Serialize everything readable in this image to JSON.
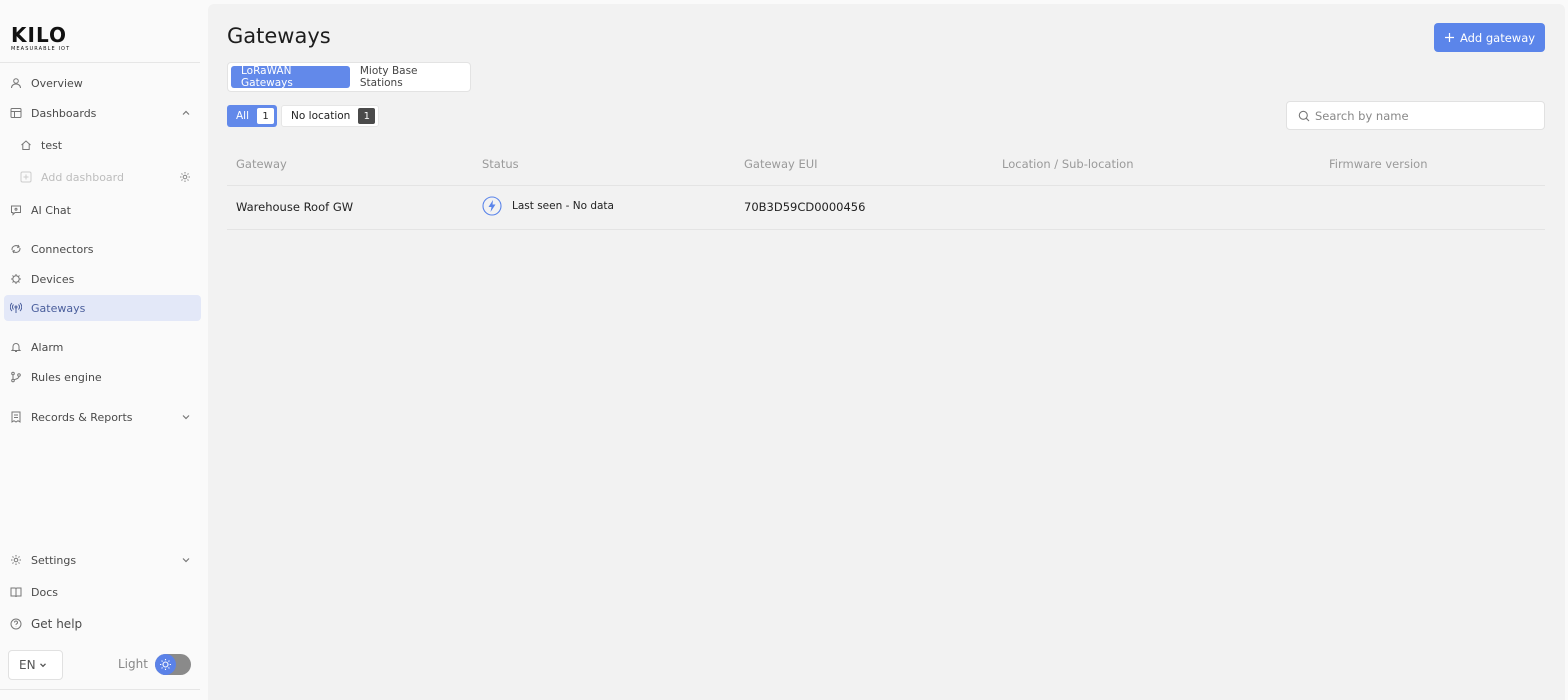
{
  "brand": {
    "name": "KILO",
    "tagline": "MEASURABLE IOT"
  },
  "sidebar": {
    "items": [
      {
        "label": "Overview",
        "icon": "user-icon"
      },
      {
        "label": "Dashboards",
        "icon": "dashboard-icon"
      },
      {
        "label": "test",
        "icon": "home-icon"
      },
      {
        "label": "Add dashboard",
        "icon": "plus-square-icon"
      },
      {
        "label": "AI Chat",
        "icon": "chat-icon"
      },
      {
        "label": "Connectors",
        "icon": "connector-icon"
      },
      {
        "label": "Devices",
        "icon": "chip-icon"
      },
      {
        "label": "Gateways",
        "icon": "antenna-icon"
      },
      {
        "label": "Alarm",
        "icon": "bell-icon"
      },
      {
        "label": "Rules engine",
        "icon": "branch-icon"
      },
      {
        "label": "Records & Reports",
        "icon": "report-icon"
      },
      {
        "label": "Settings",
        "icon": "gear-icon"
      },
      {
        "label": "Docs",
        "icon": "book-icon"
      },
      {
        "label": "Get help",
        "icon": "help-icon"
      }
    ],
    "language": "EN",
    "theme_label": "Light"
  },
  "colors": {
    "accent": "#5b85ea",
    "active_nav_bg": "#e3e8f8"
  },
  "main": {
    "title": "Gateways",
    "add_button": "Add gateway",
    "tabs": [
      "LoRaWAN Gateways",
      "Mioty Base Stations"
    ],
    "filters": [
      {
        "label": "All",
        "count": "1"
      },
      {
        "label": "No location",
        "count": "1"
      }
    ],
    "search": {
      "placeholder": "Search by name"
    },
    "table": {
      "columns": [
        "Gateway",
        "Status",
        "Gateway EUI",
        "Location / Sub-location",
        "Firmware version"
      ],
      "rows": [
        {
          "gateway": "Warehouse Roof GW",
          "status": "Last seen - No data",
          "eui": "70B3D59CD0000456",
          "location": "",
          "firmware": ""
        }
      ]
    }
  }
}
